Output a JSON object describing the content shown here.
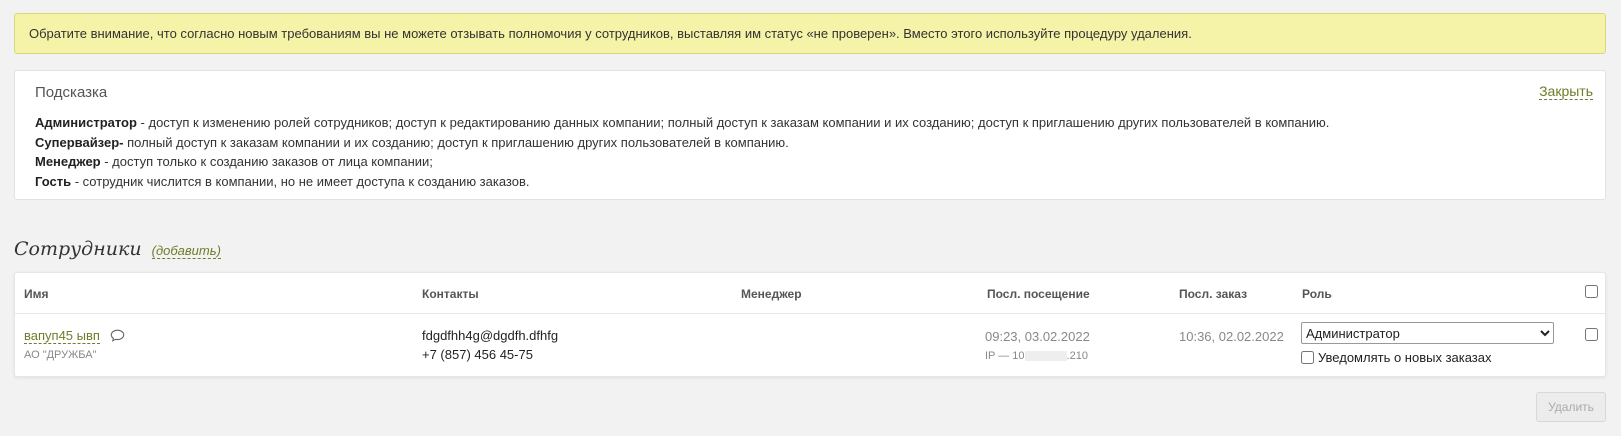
{
  "notice": {
    "text": "Обратите внимание, что согласно новым требованиям вы не можете отзывать полномочия у сотрудников, выставляя им статус «не проверен». Вместо этого используйте процедуру удаления."
  },
  "hint": {
    "title": "Подсказка",
    "close_label": "Закрыть",
    "lines": [
      {
        "role": "Администратор",
        "desc": " - доступ к изменению ролей сотрудников; доступ к редактированию данных компании; полный доступ к заказам компании и их созданию; доступ к приглашению других пользователей в компанию."
      },
      {
        "role": "Супервайзер-",
        "desc": " полный доступ к заказам компании и их созданию; доступ к приглашению других пользователей в компанию."
      },
      {
        "role": "Менеджер",
        "desc": " - доступ только к созданию заказов от лица компании;"
      },
      {
        "role": "Гость",
        "desc": " - сотрудник числится в компании, но не имеет доступа к созданию заказов."
      }
    ]
  },
  "employees": {
    "title": "Сотрудники",
    "add_label": "(добавить)",
    "columns": {
      "name": "Имя",
      "contacts": "Контакты",
      "manager": "Менеджер",
      "last_visit": "Посл. посещение",
      "last_order": "Посл. заказ",
      "role": "Роль"
    },
    "rows": [
      {
        "name": "вапуп45 ывп",
        "company": "АО \"ДРУЖБА\"",
        "email": "fdgdfhh4g@dgdfh.dfhfg",
        "phone": "+7 (857) 456 45-75",
        "manager": "",
        "last_visit": "09:23, 03.02.2022",
        "ip_prefix": "IP — 10",
        "ip_suffix": ".210",
        "last_order": "10:36, 02.02.2022",
        "role_selected": "Администратор",
        "notify_label": "Уведомлять о новых заказах"
      }
    ]
  },
  "delete_label": "Удалить",
  "colors": {
    "accent": "#6d7d2a",
    "notice_bg": "#f4f3a8"
  }
}
